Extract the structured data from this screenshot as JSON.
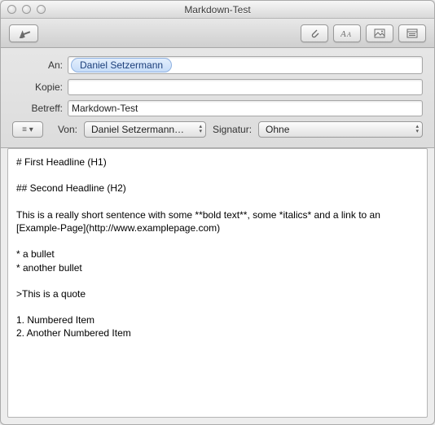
{
  "window": {
    "title": "Markdown-Test"
  },
  "toolbar": {
    "send_icon": "send-icon",
    "attach_icon": "paperclip-icon",
    "fonts_icon": "fonts-icon",
    "photo_icon": "photo-icon",
    "stationery_icon": "stationery-icon"
  },
  "fields": {
    "to_label": "An:",
    "to_token": "Daniel Setzermann",
    "cc_label": "Kopie:",
    "cc_value": "",
    "subject_label": "Betreff:",
    "subject_value": "Markdown-Test",
    "from_label": "Von:",
    "from_value": "Daniel Setzermann…",
    "sig_label": "Signatur:",
    "sig_value": "Ohne",
    "options_glyph": "≡ ▾"
  },
  "body_text": "# First Headline (H1)\n\n## Second Headline (H2)\n\nThis is a really short sentence with some **bold text**, some *italics* and a link to an [Example-Page](http://www.examplepage.com)\n\n* a bullet\n* another bullet\n\n>This is a quote\n\n1. Numbered Item\n2. Another Numbered Item"
}
